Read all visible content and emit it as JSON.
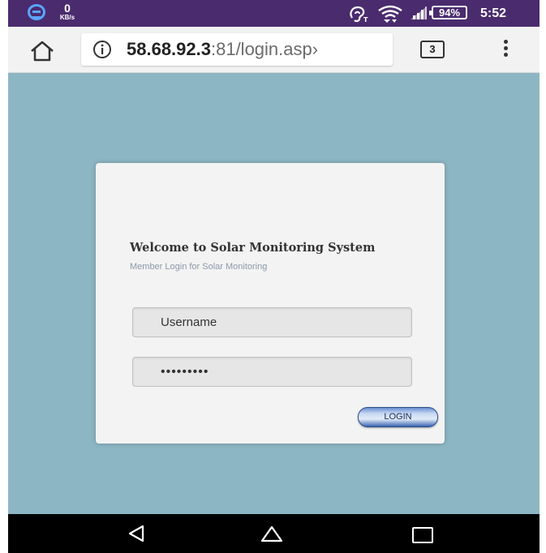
{
  "status_bar": {
    "speed_value": "0",
    "speed_unit": "KB/s",
    "battery": "94%",
    "time": "5:52",
    "icons": [
      "app-logo-icon",
      "hearing-aid-icon",
      "wifi-icon",
      "signal-icon"
    ]
  },
  "browser": {
    "url_host": "58.68.92.3",
    "url_rest": ":81/login.asp›",
    "tab_count": "3",
    "icons": [
      "home-icon",
      "info-icon",
      "tabs-icon",
      "more-vert-icon"
    ]
  },
  "login": {
    "title": "Welcome to Solar Monitoring System",
    "subtitle": "Member Login for Solar Monitoring",
    "username_value": "Username",
    "password_value": "•••••••••",
    "login_label": "LOGIN"
  },
  "nav_bar": {
    "icons": [
      "back-icon",
      "home-icon",
      "recent-apps-icon"
    ]
  },
  "colors": {
    "status_bar": "#4a2b6e",
    "page_background": "#8db6c4",
    "card_background": "#f3f3f3",
    "button_border": "#2c4d8a"
  }
}
